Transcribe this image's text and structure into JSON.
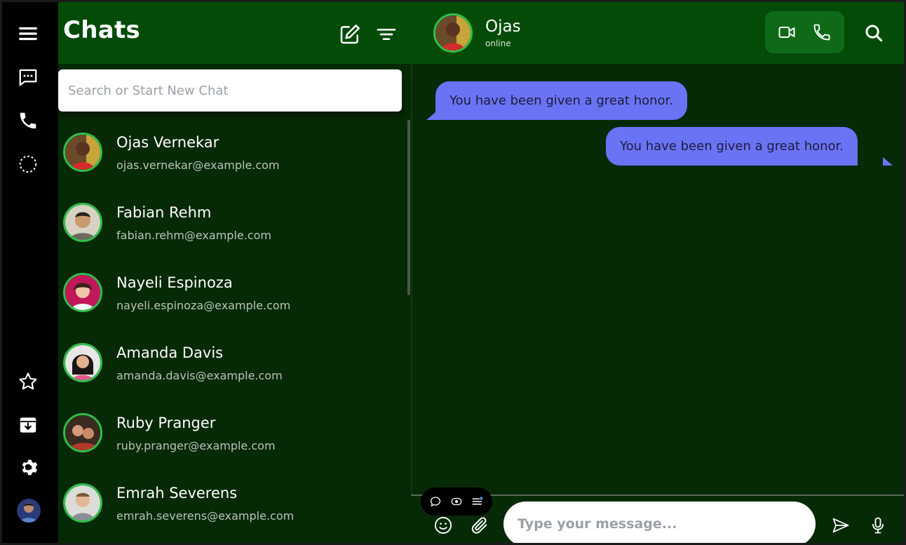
{
  "sidebar": {
    "title": "Chats",
    "search_placeholder": "Search or Start New Chat",
    "contacts": [
      {
        "name": "Ojas Vernekar",
        "email": "ojas.vernekar@example.com"
      },
      {
        "name": "Fabian Rehm",
        "email": "fabian.rehm@example.com"
      },
      {
        "name": "Nayeli Espinoza",
        "email": "nayeli.espinoza@example.com"
      },
      {
        "name": "Amanda Davis",
        "email": "amanda.davis@example.com"
      },
      {
        "name": "Ruby Pranger",
        "email": "ruby.pranger@example.com"
      },
      {
        "name": "Emrah Severens",
        "email": "emrah.severens@example.com"
      }
    ]
  },
  "chat": {
    "contact_name": "Ojas",
    "status": "online",
    "messages": [
      {
        "direction": "incoming",
        "text": "You have been given a great honor."
      },
      {
        "direction": "outgoing",
        "text": "You have been given a great honor."
      }
    ],
    "composer_placeholder": "Type your message..."
  },
  "icons": {
    "rail": [
      "menu-icon",
      "chat-icon",
      "phone-icon",
      "status-icon",
      "star-icon",
      "archive-icon",
      "settings-icon"
    ],
    "header": [
      "compose-icon",
      "filter-icon",
      "video-call-icon",
      "voice-call-icon",
      "search-icon"
    ],
    "composer": [
      "emoji-icon",
      "attach-icon",
      "send-icon",
      "mic-icon"
    ]
  },
  "colors": {
    "header_bg": "#034b07",
    "panel_bg": "#062906",
    "rail_bg": "#000000",
    "bubble": "#6b73f5",
    "avatar_ring": "#2fbf4a"
  }
}
